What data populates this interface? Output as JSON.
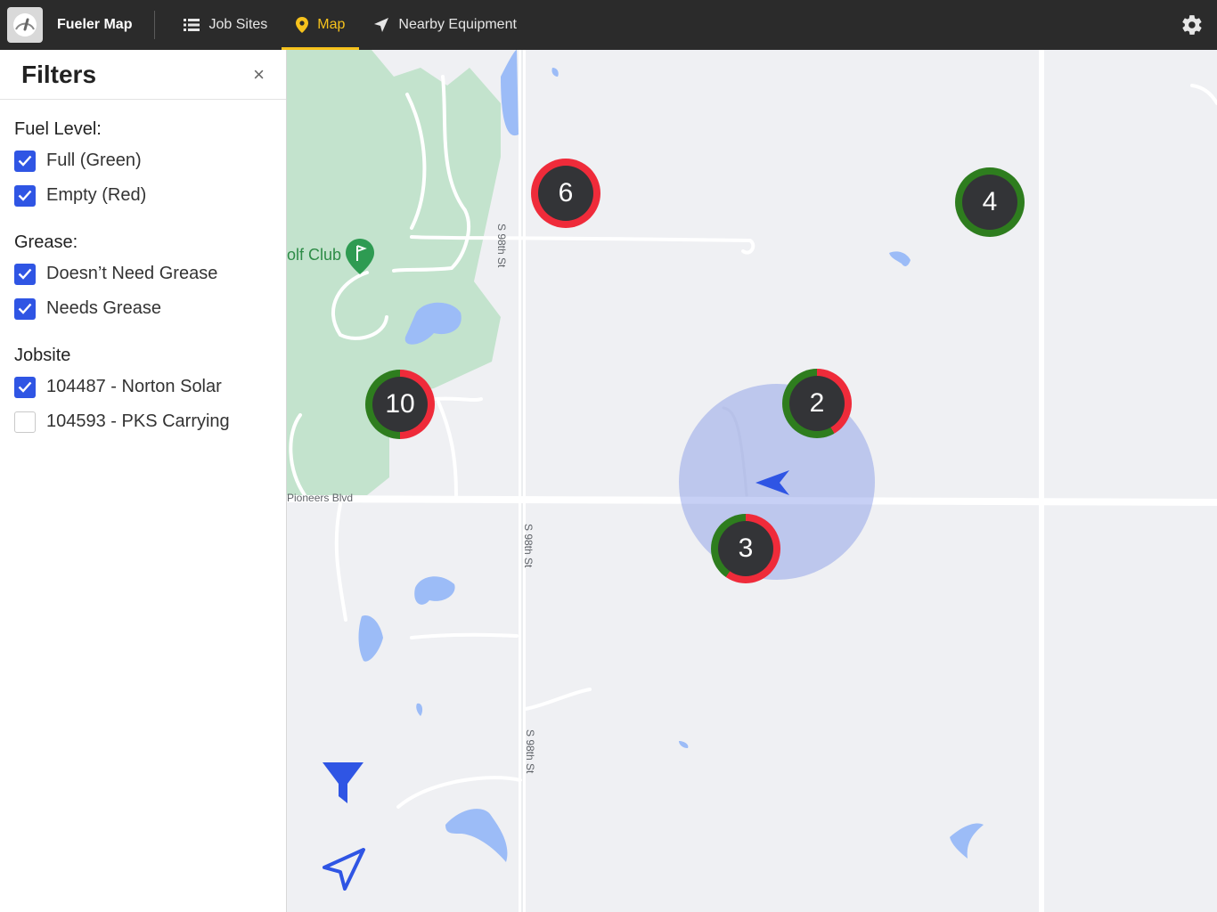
{
  "app": {
    "title": "Fueler Map"
  },
  "nav": {
    "items": [
      {
        "label": "Job Sites",
        "icon": "list-icon",
        "active": false
      },
      {
        "label": "Map",
        "icon": "map-pin-icon",
        "active": true
      },
      {
        "label": "Nearby Equipment",
        "icon": "navigation-arrow-icon",
        "active": false
      }
    ],
    "settings_icon": "gear-icon"
  },
  "filters": {
    "title": "Filters",
    "close_label": "×",
    "groups": [
      {
        "title": "Fuel Level:",
        "options": [
          {
            "label": "Full (Green)",
            "checked": true
          },
          {
            "label": "Empty (Red)",
            "checked": true
          }
        ]
      },
      {
        "title": "Grease:",
        "options": [
          {
            "label": "Doesn’t Need Grease",
            "checked": true
          },
          {
            "label": "Needs Grease",
            "checked": true
          }
        ]
      },
      {
        "title": "Jobsite",
        "options": [
          {
            "label": "104487 - Norton Solar",
            "checked": true
          },
          {
            "label": "104593 - PKS Carrying",
            "checked": false
          }
        ]
      }
    ]
  },
  "map": {
    "labels": {
      "road_98th_a": "S 98th St",
      "road_98th_b": "S 98th St",
      "road_98th_c": "S 98th St",
      "pioneers": "Pioneers Blvd",
      "golf": "olf Club"
    },
    "clusters": [
      {
        "count": "6",
        "ring": "red"
      },
      {
        "count": "4",
        "ring": "green"
      },
      {
        "count": "10",
        "ring": "mixed"
      },
      {
        "count": "2",
        "ring": "mixed"
      },
      {
        "count": "3",
        "ring": "mixed"
      }
    ],
    "colors": {
      "accent": "#f6c21c",
      "primary_blue": "#2f55e4",
      "fuel_full": "#2e7d1e",
      "fuel_empty": "#ef2b3a",
      "park": "#c3e3cd",
      "water": "#9cbcf7"
    }
  }
}
